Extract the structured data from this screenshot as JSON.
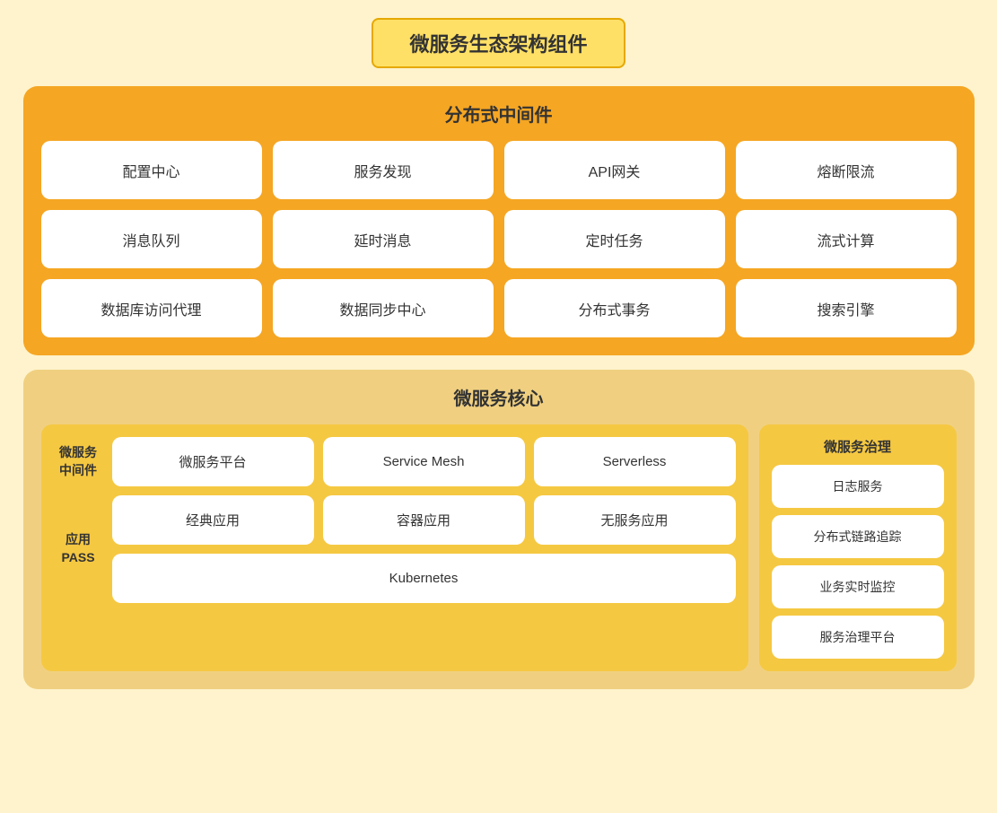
{
  "page": {
    "title": "微服务生态架构组件"
  },
  "distributed": {
    "sectionTitle": "分布式中间件",
    "row1": [
      "配置中心",
      "服务发现",
      "API网关",
      "熔断限流"
    ],
    "row2": [
      "消息队列",
      "延时消息",
      "定时任务",
      "流式计算"
    ],
    "row3": [
      "数据库访问代理",
      "数据同步中心",
      "分布式事务",
      "搜索引擎"
    ]
  },
  "microservice": {
    "sectionTitle": "微服务核心",
    "left": {
      "middlewareLabel": "微服务\n中间件",
      "middlewareCards": [
        "微服务平台",
        "Service Mesh",
        "Serverless"
      ],
      "appLabel": "应用\nPASS",
      "appCards": [
        "经典应用",
        "容器应用",
        "无服务应用"
      ],
      "k8sLabel": "Kubernetes"
    },
    "right": {
      "title": "微服务治理",
      "cards": [
        "日志服务",
        "分布式链路追踪",
        "业务实时监控",
        "服务治理平台"
      ]
    }
  }
}
